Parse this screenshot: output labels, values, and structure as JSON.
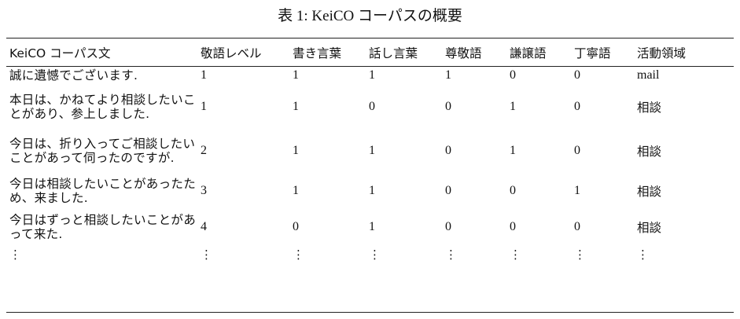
{
  "caption": "表 1: KeiCO コーパスの概要",
  "headers": [
    "KeiCO コーパス文",
    "敬語レベル",
    "書き言葉",
    "話し言葉",
    "尊敬語",
    "謙譲語",
    "丁寧語",
    "活動領域"
  ],
  "rows": [
    [
      "誠に遺憾でございます.",
      "1",
      "1",
      "1",
      "1",
      "0",
      "0",
      "mail"
    ],
    [
      "本日は、かねてより相談したいことがあり、参上しました.",
      "1",
      "1",
      "0",
      "0",
      "1",
      "0",
      "相談"
    ],
    [
      "今日は、折り入ってご相談したいことがあって伺ったのですが.",
      "2",
      "1",
      "1",
      "0",
      "1",
      "0",
      "相談"
    ],
    [
      "今日は相談したいことがあったため、来ました.",
      "3",
      "1",
      "1",
      "0",
      "0",
      "1",
      "相談"
    ],
    [
      "今日はずっと相談したいことがあって来た.",
      "4",
      "0",
      "1",
      "0",
      "0",
      "0",
      "相談"
    ]
  ],
  "continuation": "⋮"
}
